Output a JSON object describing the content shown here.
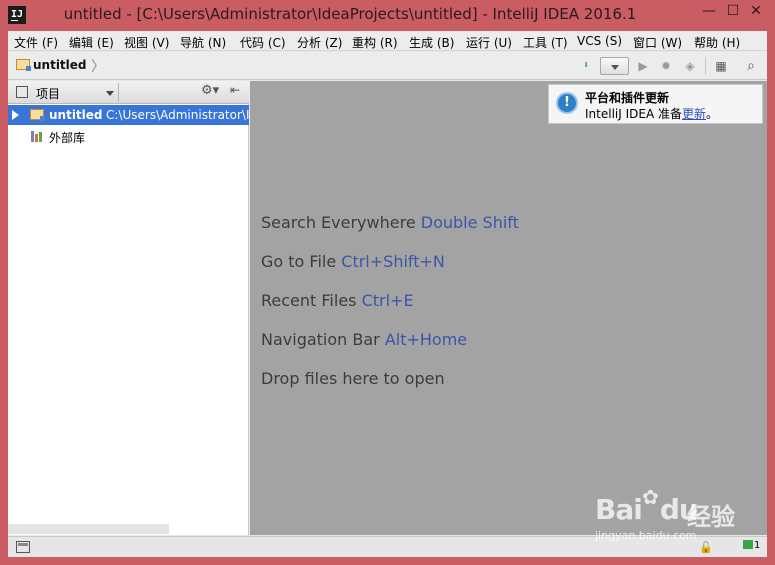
{
  "window": {
    "title": "untitled - [C:\\Users\\Administrator\\IdeaProjects\\untitled] - IntelliJ IDEA 2016.1",
    "app_icon_text": "IJ",
    "minimize": "—",
    "maximize": "☐",
    "close": "✕"
  },
  "menubar": {
    "items": [
      {
        "label": "文件 (F)"
      },
      {
        "label": "编辑 (E)"
      },
      {
        "label": "视图 (V)"
      },
      {
        "label": "导航 (N)"
      },
      {
        "label": "代码 (C)"
      },
      {
        "label": "分析 (Z)"
      },
      {
        "label": "重构 (R)"
      },
      {
        "label": "生成 (B)"
      },
      {
        "label": "运行 (U)"
      },
      {
        "label": "工具 (T)"
      },
      {
        "label": "VCS (S)"
      },
      {
        "label": "窗口 (W)"
      },
      {
        "label": "帮助 (H)"
      }
    ]
  },
  "navbar": {
    "breadcrumb": "untitled",
    "separator": "〉",
    "icons": {
      "make": "⬇",
      "run": "▶",
      "debug": "✹",
      "coverage": "◈",
      "structure": "▦",
      "search": "⌕"
    }
  },
  "project_panel": {
    "view_label": "项目",
    "gear": "⚙▾",
    "hide": "⇤",
    "tree": [
      {
        "name": "untitled",
        "path": "C:\\Users\\Administrator\\IdeaProjects\\untitled"
      },
      {
        "name": "外部库",
        "path": ""
      }
    ]
  },
  "editor": {
    "hints": [
      {
        "text": "Search Everywhere ",
        "key": "Double Shift"
      },
      {
        "text": "Go to File ",
        "key": "Ctrl+Shift+N"
      },
      {
        "text": "Recent Files ",
        "key": "Ctrl+E"
      },
      {
        "text": "Navigation Bar ",
        "key": "Alt+Home"
      },
      {
        "text": "Drop files here to open",
        "key": ""
      }
    ]
  },
  "notification": {
    "icon": "!",
    "title": "平台和插件更新",
    "body_prefix": "IntelliJ IDEA 准备",
    "link": "更新",
    "body_suffix": "。"
  },
  "statusbar": {
    "lock_icon": "🔓",
    "event_count": "1"
  },
  "watermark": {
    "logo": "Bai",
    "logo2": "du",
    "cn": "经验",
    "url": "jingyan.baidu.com"
  }
}
